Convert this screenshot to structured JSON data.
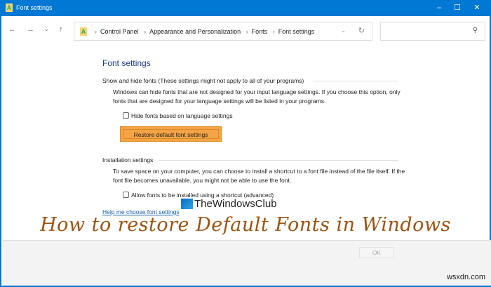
{
  "window": {
    "title": "Font settings",
    "app_icon": "font-folder-icon"
  },
  "nav": {
    "breadcrumb": [
      "Control Panel",
      "Appearance and Personalization",
      "Fonts",
      "Font settings"
    ],
    "search_placeholder": ""
  },
  "main": {
    "heading": "Font settings",
    "show_hide": {
      "title": "Show and hide fonts (These settings might not apply to all of your programs)",
      "description": "Windows can hide fonts that are not designed for your input language settings. If you choose this option, only fonts that are designed for your language settings will be listed in your programs.",
      "checkbox_label": "Hide fonts based on language settings",
      "checked": false,
      "restore_button": "Restore default font settings"
    },
    "installation": {
      "title": "Installation settings",
      "description": "To save space on your computer, you can choose to install a shortcut to a font file instead of the file itself. If the font file becomes unavailable, you might not be able to use the font.",
      "checkbox_label": "Allow fonts to be installed using a shortcut (advanced)",
      "checked": false
    },
    "help_link": "Help me choose font settings"
  },
  "footer": {
    "ok_label": "OK"
  },
  "overlay": {
    "logo_text": "TheWindowsClub",
    "headline": "How to restore Default Fonts in Windows",
    "watermark": "wsxdn.com"
  },
  "colors": {
    "accent": "#0078d4",
    "highlight": "#f5a445",
    "headline": "#a0520f"
  }
}
